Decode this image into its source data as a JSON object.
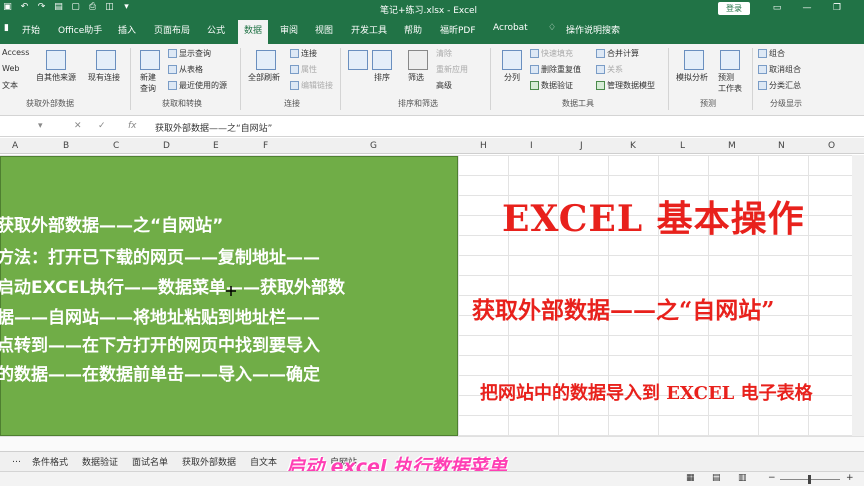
{
  "titlebar": {
    "title": "笔记+练习.xlsx  -  Excel",
    "login_label": "登录",
    "qat_icons": [
      "save-icon",
      "undo-icon",
      "redo-icon",
      "open-icon",
      "new-icon",
      "print-icon",
      "preview-icon",
      "dropdown-icon"
    ]
  },
  "tabs": [
    "开始",
    "Office助手",
    "插入",
    "页面布局",
    "公式",
    "数据",
    "审阅",
    "视图",
    "开发工具",
    "帮助",
    "福昕PDF",
    "Acrobat",
    "操作说明搜索"
  ],
  "active_tab": "数据",
  "ribbon": {
    "get_external": {
      "items": [
        "Access",
        "Web",
        "文本",
        "自其他来源",
        "现有连接"
      ],
      "group": "获取外部数据"
    },
    "get_transform": {
      "new_query": "新建\n查询",
      "items": [
        "显示查询",
        "从表格",
        "最近使用的源"
      ],
      "group": "获取和转换"
    },
    "connections": {
      "refresh": "全部刷新",
      "items": [
        "连接",
        "属性",
        "编辑链接"
      ],
      "group": "连接"
    },
    "sort_filter": {
      "sort": "排序",
      "filter": "筛选",
      "items": [
        "清除",
        "重新应用",
        "高级"
      ],
      "group": "排序和筛选"
    },
    "data_tools": {
      "split": "分列",
      "items": [
        "快速填充",
        "删除重复值",
        "数据验证",
        "合并计算",
        "关系",
        "管理数据模型"
      ],
      "group": "数据工具"
    },
    "forecast": {
      "items": [
        "模拟分析",
        "预测\n工作表"
      ],
      "group": "预测"
    },
    "outline": {
      "items": [
        "组合",
        "取消组合",
        "分类汇总"
      ],
      "group": "分级显示"
    }
  },
  "formula_bar": {
    "fx": "fx",
    "content": "获取外部数据——之“自网站”"
  },
  "columns": [
    "A",
    "B",
    "C",
    "D",
    "E",
    "F",
    "G",
    "H",
    "I",
    "J",
    "K",
    "L",
    "M",
    "N",
    "O"
  ],
  "green_box": {
    "lines": [
      "获取外部数据——之“自网站”",
      "方法：打开已下载的网页——复制地址——",
      "启动EXCEL执行——数据菜单——获取外部数",
      "据——自网站——将地址粘贴到地址栏——",
      "点转到——在下方打开的网页中找到要导入",
      "的数据——在数据前单击——导入——确定"
    ]
  },
  "red_text": {
    "title": "EXCEL 基本操作",
    "subtitle": "获取外部数据——之“自网站”",
    "caption": "把网站中的数据导入到 EXCEL 电子表格"
  },
  "sheet_tabs": [
    "条件格式",
    "数据验证",
    "面试名单",
    "获取外部数据",
    "自文本",
    "自网站"
  ],
  "video_subtitle": "启动 excel 执行数据菜单",
  "colors": {
    "excel_green": "#217346",
    "box_green": "#70ad47",
    "red": "#e8211c",
    "pink": "#ff3fb4"
  }
}
